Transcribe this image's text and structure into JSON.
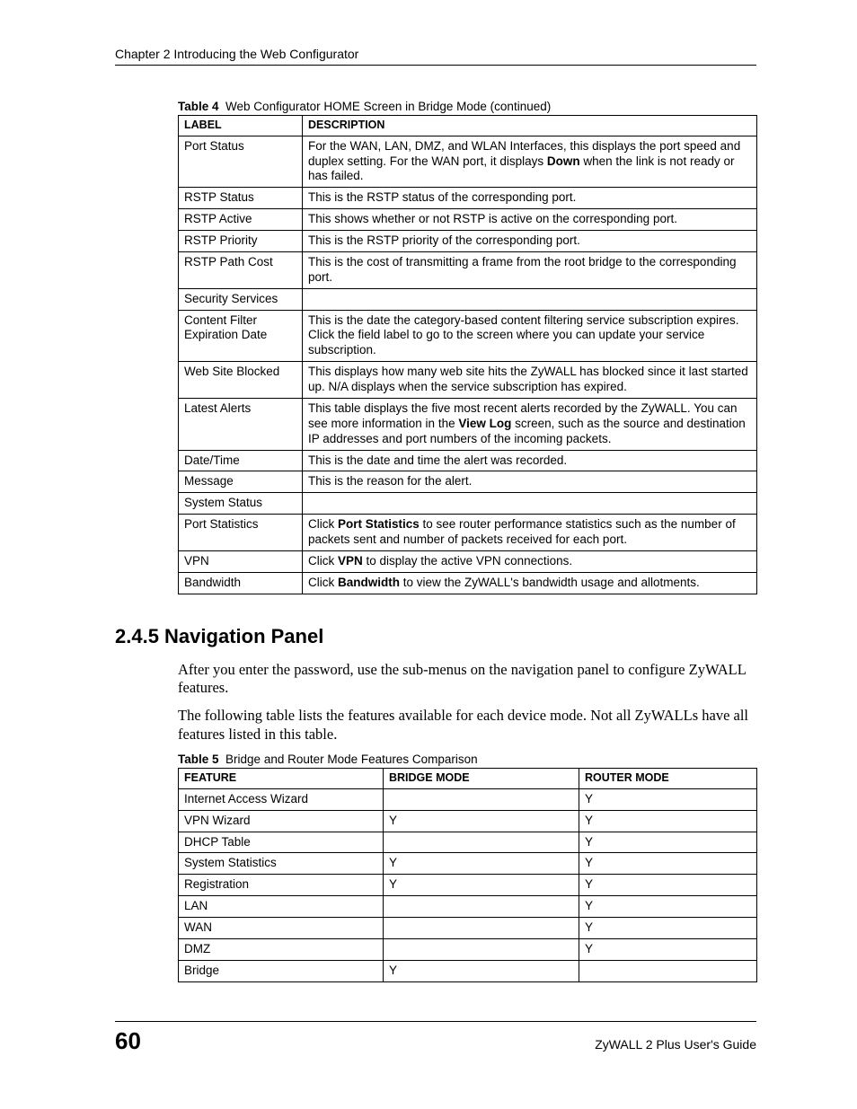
{
  "header": {
    "chapter": "Chapter 2 Introducing the Web Configurator"
  },
  "table4": {
    "caption_num": "Table 4",
    "caption_text": "Web Configurator HOME Screen in Bridge Mode (continued)",
    "headers": [
      "LABEL",
      "DESCRIPTION"
    ],
    "rows": [
      {
        "label": "Port Status",
        "desc_a": "For the WAN, LAN, DMZ, and WLAN Interfaces, this displays the port speed and duplex setting. For the WAN port, it displays ",
        "desc_bold": "Down",
        "desc_b": " when the link is not ready or has failed."
      },
      {
        "label": "RSTP Status",
        "desc": "This is the RSTP status of the corresponding port."
      },
      {
        "label": "RSTP Active",
        "desc": "This shows whether or not RSTP is active on the corresponding port."
      },
      {
        "label": "RSTP Priority",
        "desc": "This is the RSTP priority of the corresponding port."
      },
      {
        "label": "RSTP Path Cost",
        "desc": "This is the cost of transmitting a frame from the root bridge to the corresponding port."
      },
      {
        "label": "Security Services",
        "desc": ""
      },
      {
        "label": "Content Filter Expiration Date",
        "desc": "This is the date the category-based content filtering service subscription expires. Click the field label to go to the screen where you can update your service subscription."
      },
      {
        "label": "Web Site Blocked",
        "desc": "This displays how many web site hits the ZyWALL has blocked since it last started up. N/A displays when the service subscription has expired."
      },
      {
        "label": "Latest Alerts",
        "desc_a": "This table displays the five most recent alerts recorded by the ZyWALL. You can see more information in the ",
        "desc_bold": "View Log",
        "desc_b": " screen, such as the source and destination IP addresses and port numbers of the incoming packets."
      },
      {
        "label": "Date/Time",
        "desc": "This is the date and time the alert was recorded."
      },
      {
        "label": "Message",
        "desc": "This is the reason for the alert."
      },
      {
        "label": "System Status",
        "desc": ""
      },
      {
        "label": "Port Statistics",
        "desc_a": "Click ",
        "desc_bold": "Port Statistics",
        "desc_b": " to see router performance statistics such as the number of packets sent and number of packets received for each port."
      },
      {
        "label": "VPN",
        "desc_a": "Click ",
        "desc_bold": "VPN",
        "desc_b": " to display the active VPN connections."
      },
      {
        "label": "Bandwidth",
        "desc_a": "Click ",
        "desc_bold": "Bandwidth",
        "desc_b": " to view the ZyWALL's bandwidth usage and allotments."
      }
    ]
  },
  "section": {
    "heading": "2.4.5  Navigation Panel",
    "para1": "After you enter the password, use the sub-menus on the navigation panel to configure ZyWALL features.",
    "para2": "The following table lists the features available for each device mode. Not all ZyWALLs have all features listed in this table."
  },
  "table5": {
    "caption_num": "Table 5",
    "caption_text": "Bridge and Router Mode Features Comparison",
    "headers": [
      "FEATURE",
      "BRIDGE MODE",
      "ROUTER MODE"
    ],
    "rows": [
      {
        "feature": "Internet Access Wizard",
        "bridge": "",
        "router": "Y"
      },
      {
        "feature": "VPN Wizard",
        "bridge": "Y",
        "router": "Y"
      },
      {
        "feature": "DHCP Table",
        "bridge": "",
        "router": "Y"
      },
      {
        "feature": "System Statistics",
        "bridge": "Y",
        "router": "Y"
      },
      {
        "feature": "Registration",
        "bridge": "Y",
        "router": "Y"
      },
      {
        "feature": "LAN",
        "bridge": "",
        "router": "Y"
      },
      {
        "feature": "WAN",
        "bridge": "",
        "router": "Y"
      },
      {
        "feature": "DMZ",
        "bridge": "",
        "router": "Y"
      },
      {
        "feature": "Bridge",
        "bridge": "Y",
        "router": ""
      }
    ]
  },
  "footer": {
    "page": "60",
    "guide": "ZyWALL 2 Plus User's Guide"
  }
}
